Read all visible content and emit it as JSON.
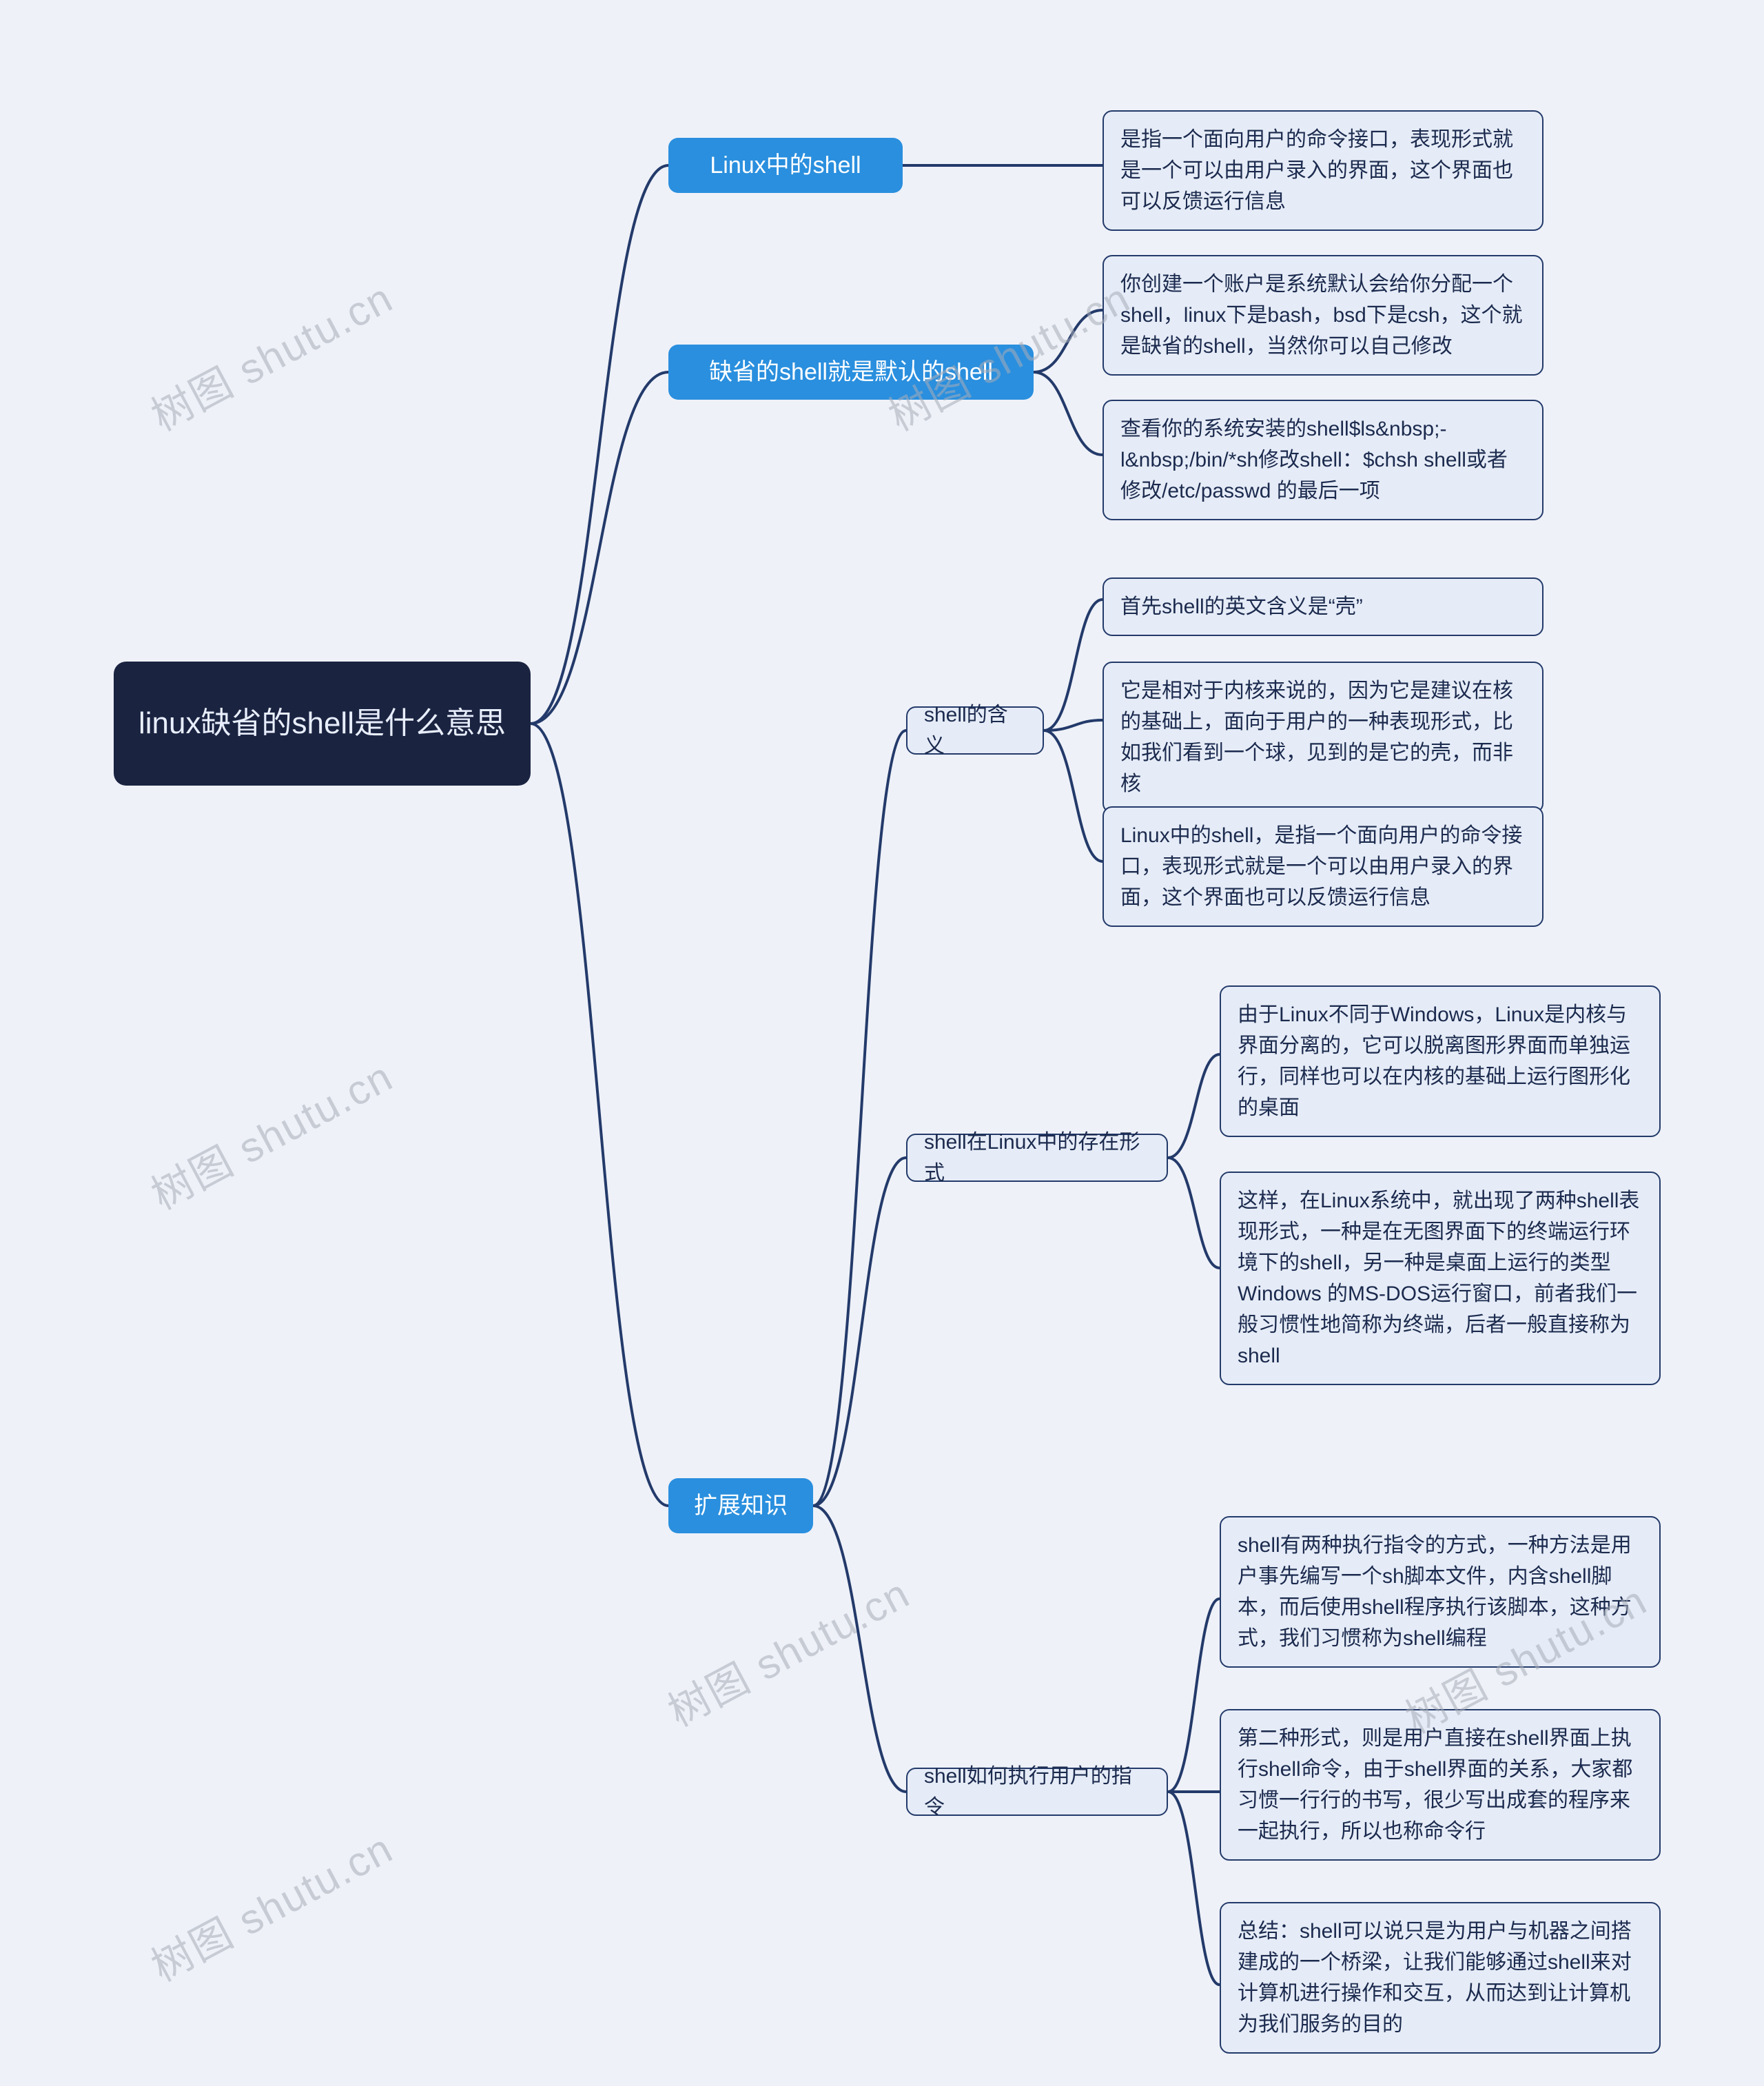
{
  "watermark": "树图 shutu.cn",
  "root": {
    "label": "linux缺省的shell是什么意思"
  },
  "branches": [
    {
      "label": "Linux中的shell",
      "children": [
        {
          "label": "是指一个面向用户的命令接口，表现形式就是一个可以由用户录入的界面，这个界面也可以反馈运行信息"
        }
      ]
    },
    {
      "label": "缺省的shell就是默认的shell",
      "children": [
        {
          "label": "你创建一个账户是系统默认会给你分配一个shell，linux下是bash，bsd下是csh，这个就是缺省的shell，当然你可以自己修改"
        },
        {
          "label": "查看你的系统安装的shell$ls&nbsp;-l&nbsp;/bin/*sh修改shell：$chsh shell或者修改/etc/passwd 的最后一项"
        }
      ]
    },
    {
      "label": "扩展知识",
      "children": [
        {
          "label": "shell的含义",
          "children": [
            {
              "label": "首先shell的英文含义是“壳”"
            },
            {
              "label": "它是相对于内核来说的，因为它是建议在核的基础上，面向于用户的一种表现形式，比如我们看到一个球，见到的是它的壳，而非核"
            },
            {
              "label": "Linux中的shell，是指一个面向用户的命令接口，表现形式就是一个可以由用户录入的界面，这个界面也可以反馈运行信息"
            }
          ]
        },
        {
          "label": "shell在Linux中的存在形式",
          "children": [
            {
              "label": "由于Linux不同于Windows，Linux是内核与界面分离的，它可以脱离图形界面而单独运行，同样也可以在内核的基础上运行图形化的桌面"
            },
            {
              "label": "这样，在Linux系统中，就出现了两种shell表现形式，一种是在无图界面下的终端运行环境下的shell，另一种是桌面上运行的类型Windows 的MS-DOS运行窗口，前者我们一般习惯性地简称为终端，后者一般直接称为shell"
            }
          ]
        },
        {
          "label": "shell如何执行用户的指令",
          "children": [
            {
              "label": "shell有两种执行指令的方式，一种方法是用户事先编写一个sh脚本文件，内含shell脚本，而后使用shell程序执行该脚本，这种方式，我们习惯称为shell编程"
            },
            {
              "label": "第二种形式，则是用户直接在shell界面上执行shell命令，由于shell界面的关系，大家都习惯一行行的书写，很少写出成套的程序来一起执行，所以也称命令行"
            },
            {
              "label": "总结：shell可以说只是为用户与机器之间搭建成的一个桥梁，让我们能够通过shell来对计算机进行操作和交互，从而达到让计算机为我们服务的目的"
            }
          ]
        }
      ]
    }
  ]
}
